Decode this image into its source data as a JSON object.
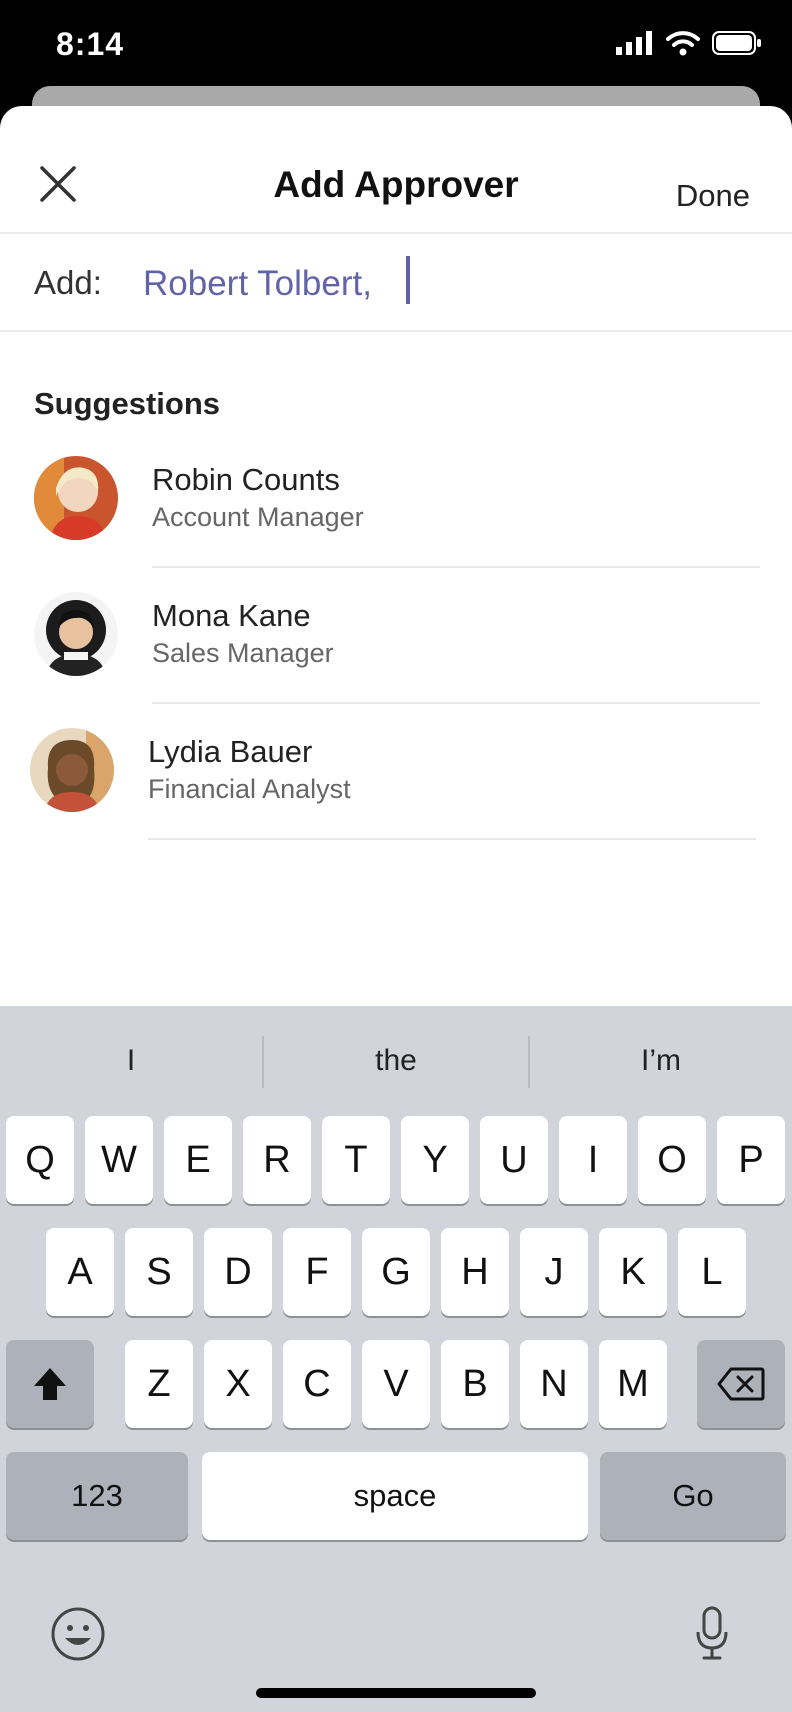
{
  "status": {
    "time": "8:14"
  },
  "header": {
    "title": "Add Approver",
    "done_label": "Done"
  },
  "add_field": {
    "label": "Add:",
    "recipient": "Robert Tolbert,"
  },
  "suggestions": {
    "title": "Suggestions",
    "people": [
      {
        "name": "Robin Counts",
        "role": "Account Manager"
      },
      {
        "name": "Mona Kane",
        "role": "Sales Manager"
      },
      {
        "name": "Lydia Bauer",
        "role": "Financial Analyst"
      }
    ]
  },
  "keyboard": {
    "predictions": [
      "I",
      "the",
      "I’m"
    ],
    "row1": [
      "Q",
      "W",
      "E",
      "R",
      "T",
      "Y",
      "U",
      "I",
      "O",
      "P"
    ],
    "row2": [
      "A",
      "S",
      "D",
      "F",
      "G",
      "H",
      "J",
      "K",
      "L"
    ],
    "row3": [
      "Z",
      "X",
      "C",
      "V",
      "B",
      "N",
      "M"
    ],
    "numbers_label": "123",
    "space_label": "space",
    "go_label": "Go"
  },
  "colors": {
    "accent": "#6264a7"
  }
}
